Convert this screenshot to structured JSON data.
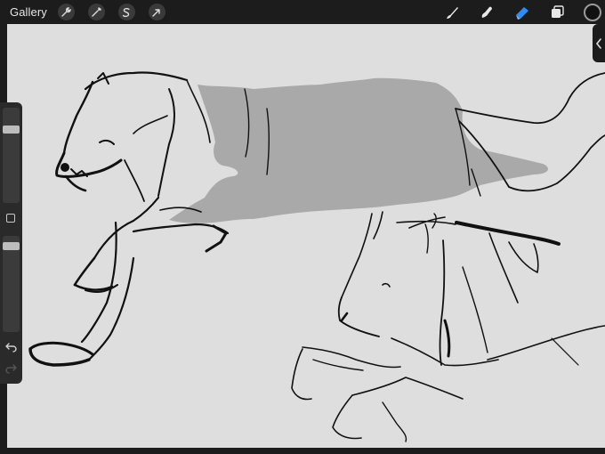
{
  "topbar": {
    "gallery_label": "Gallery",
    "tools": [
      "wrench-icon",
      "magic-wand-icon",
      "selection-s-icon",
      "transform-arrow-icon"
    ],
    "right_tools": [
      "brush-icon",
      "smudge-icon",
      "eraser-icon",
      "layers-icon"
    ],
    "active_tool": "eraser-icon",
    "active_tool_color": "#2f8ef5",
    "current_color": "#111111"
  },
  "sidebar": {
    "size_slider_level": 0.15,
    "opacity_slider_level": 0.05
  },
  "colors": {
    "canvas": "#dedede",
    "shadow_fill": "#a9a9a9",
    "ink": "#111111",
    "chrome": "#1c1c1c"
  }
}
